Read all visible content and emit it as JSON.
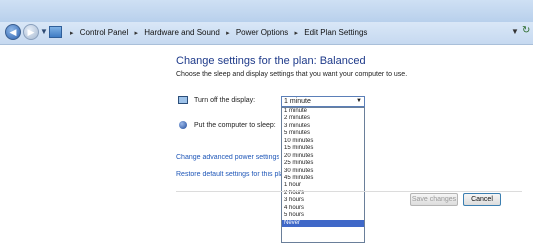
{
  "breadcrumb": {
    "items": [
      "Control Panel",
      "Hardware and Sound",
      "Power Options",
      "Edit Plan Settings"
    ],
    "separator": "▸"
  },
  "page": {
    "title": "Change settings for the plan: Balanced",
    "subtitle": "Choose the sleep and display settings that you want your computer to use."
  },
  "settings": {
    "display_label": "Turn off the display:",
    "display_value": "1 minute",
    "sleep_label": "Put the computer to sleep:"
  },
  "dropdown": {
    "options": [
      "1 minute",
      "2 minutes",
      "3 minutes",
      "5 minutes",
      "10 minutes",
      "15 minutes",
      "20 minutes",
      "25 minutes",
      "30 minutes",
      "45 minutes",
      "1 hour",
      "2 hours",
      "3 hours",
      "4 hours",
      "5 hours",
      "Never"
    ],
    "highlighted": "Never"
  },
  "links": {
    "advanced": "Change advanced power settings",
    "restore": "Restore default settings for this plan"
  },
  "buttons": {
    "save": "Save changes",
    "cancel": "Cancel"
  },
  "colors": {
    "title": "#1e3a8a",
    "link": "#1f57b8",
    "highlight": "#3f68c8"
  }
}
